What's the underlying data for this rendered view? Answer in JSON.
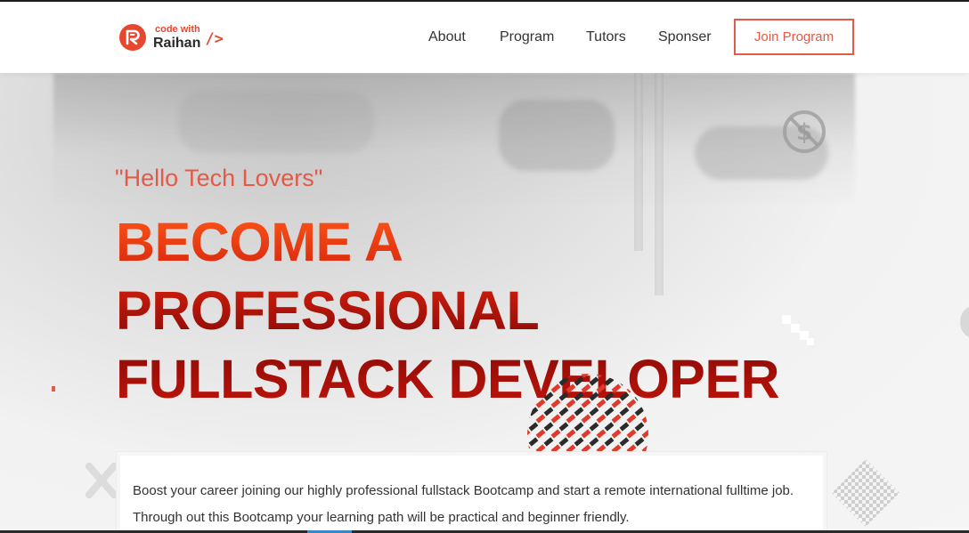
{
  "brand": {
    "logo_small": "code with",
    "logo_big": "Raihan",
    "logo_slash": "/>"
  },
  "nav": {
    "items": [
      {
        "label": "About"
      },
      {
        "label": "Program"
      },
      {
        "label": "Tutors"
      },
      {
        "label": "Sponser"
      }
    ],
    "cta_label": "Join Program"
  },
  "hero": {
    "greeting": "\"Hello Tech Lovers\"",
    "headline_lines": [
      "BECOME A",
      "PROFESSIONAL",
      "FULLSTACK DEVELOPER"
    ],
    "description": "Boost your career joining our highly professional fullstack Bootcamp and start a remote international fulltime job. Through out this Bootcamp your learning path will be practical and beginner friendly."
  },
  "colors": {
    "accent": "#e35a47",
    "logo_red": "#e8472f",
    "text_dark": "#333333",
    "headline_red": "#d31f0c"
  },
  "icons": {
    "logo": "r-letter-logo-icon",
    "decor_top": "no-dollar-icon"
  }
}
